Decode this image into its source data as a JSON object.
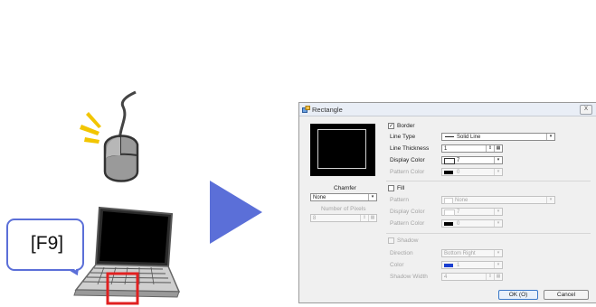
{
  "illustration": {
    "key_callout": "[F9]",
    "colors": {
      "accent_blue": "#5b6fd8",
      "highlight_red": "#e02020",
      "spark_yellow": "#f2c500"
    },
    "icons": [
      "mouse-icon",
      "laptop-icon",
      "right-arrow-icon"
    ]
  },
  "dialog": {
    "title": "Rectangle",
    "close_label": "X",
    "chamfer": {
      "label": "Chamfer",
      "value": "None",
      "pixels_label": "Number of Pixels",
      "pixels_value": "8"
    },
    "border": {
      "label": "Border",
      "checked": true,
      "line_type_label": "Line Type",
      "line_type_value": "Solid Line",
      "line_thickness_label": "Line Thickness",
      "line_thickness_value": "1",
      "display_color_label": "Display Color",
      "display_color_value": "7",
      "pattern_color_label": "Pattern Color",
      "pattern_color_value": "0"
    },
    "fill": {
      "label": "Fill",
      "checked": false,
      "pattern_label": "Pattern",
      "pattern_value": "None",
      "display_color_label": "Display Color",
      "display_color_value": "7",
      "pattern_color_label": "Pattern Color",
      "pattern_color_value": "0"
    },
    "shadow": {
      "label": "Shadow",
      "checked": false,
      "direction_label": "Direction",
      "direction_value": "Bottom Right",
      "color_label": "Color",
      "color_value": "1",
      "width_label": "Shadow Width",
      "width_value": "4"
    },
    "ok_label": "OK (O)",
    "cancel_label": "Cancel"
  }
}
